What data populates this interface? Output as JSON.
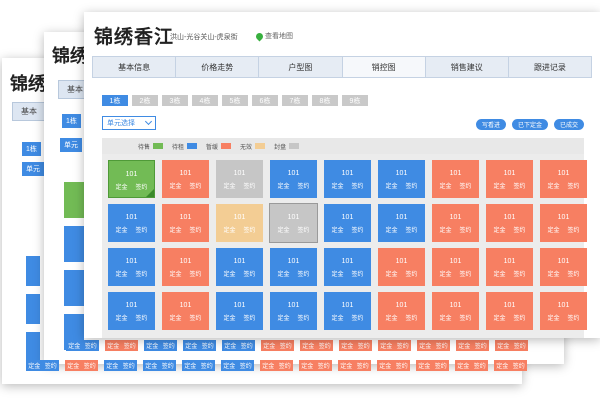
{
  "title": "锦绣香江",
  "address": "洪山-光谷关山-虎泉街",
  "map_link": "查看地图",
  "tabs": [
    {
      "label": "基本信息"
    },
    {
      "label": "价格走势"
    },
    {
      "label": "户型图"
    },
    {
      "label": "销控图"
    },
    {
      "label": "销售建议"
    },
    {
      "label": "跟进记录"
    }
  ],
  "active_tab": "销控图",
  "buildings": [
    "1栋",
    "2栋",
    "3栋",
    "4栋",
    "5栋",
    "6栋",
    "7栋",
    "8栋",
    "9栋"
  ],
  "unit_select": {
    "label": "单元选择"
  },
  "actions": [
    "写看进",
    "已下定金",
    "已成交"
  ],
  "legend": [
    {
      "label": "待售",
      "color": "#72bb55"
    },
    {
      "label": "待租",
      "color": "#3f8be3"
    },
    {
      "label": "暂缓",
      "color": "#f77f62"
    },
    {
      "label": "无效",
      "color": "#f3cd94"
    },
    {
      "label": "封盘",
      "color": "#c6c6c6"
    }
  ],
  "room_labels": {
    "number": "101",
    "deposit": "定金",
    "contract": "签约"
  },
  "rows": [
    [
      "selected",
      "sold",
      "invalid",
      "available",
      "available",
      "available",
      "sold",
      "sold",
      "sold"
    ],
    [
      "available",
      "sold",
      "hold",
      "invalid",
      "available",
      "available",
      "sold",
      "sold",
      "sold"
    ],
    [
      "available",
      "sold",
      "available",
      "available",
      "available",
      "sold",
      "sold",
      "sold",
      "sold"
    ],
    [
      "available",
      "sold",
      "available",
      "available",
      "available",
      "sold",
      "sold",
      "sold",
      "sold"
    ]
  ],
  "ghost": {
    "title_1": "锦绣",
    "title_2": "锦绣",
    "tab_1": "基本",
    "tab_2": "基本",
    "small_1": "1栋",
    "small_2": "1栋",
    "unit_1": "单元",
    "unit_2": "单元"
  }
}
